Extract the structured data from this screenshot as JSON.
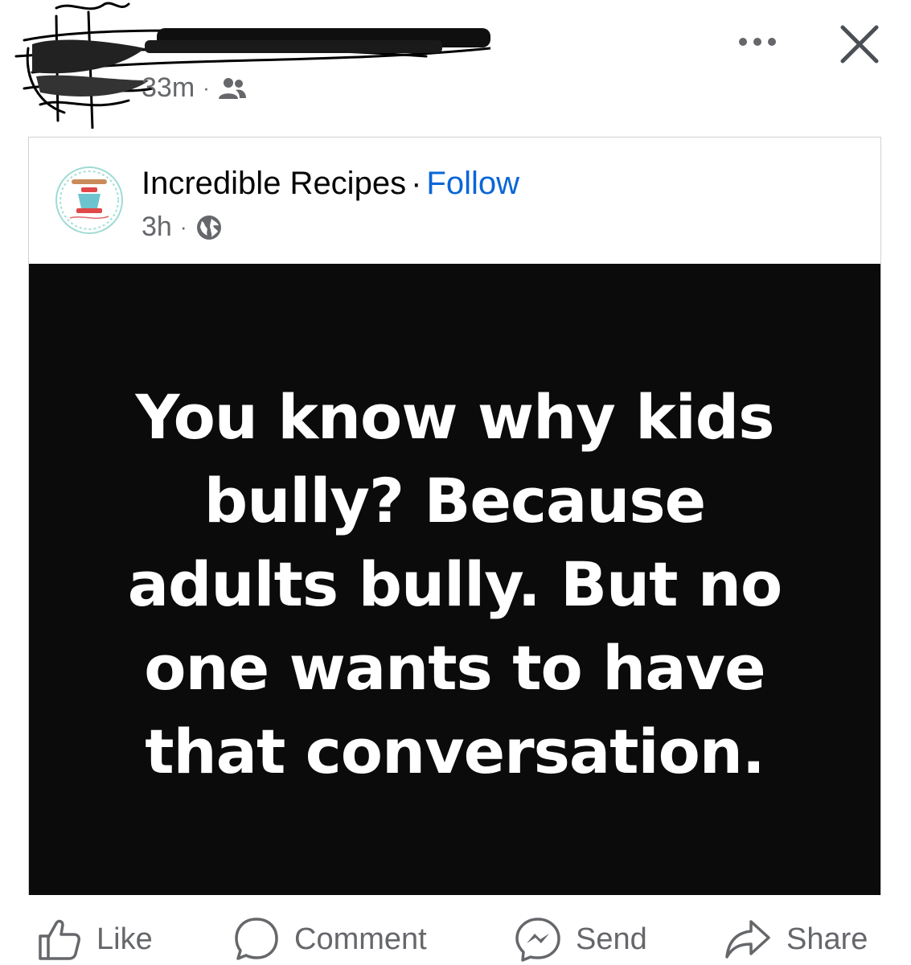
{
  "outer_post": {
    "timestamp": "33m",
    "separator": "·",
    "audience_icon": "friends-icon"
  },
  "header_actions": {
    "more_icon": "more-options-icon",
    "close_icon": "close-icon"
  },
  "shared_post": {
    "page_name": "Incredible Recipes",
    "title_separator": "·",
    "follow_label": "Follow",
    "timestamp": "3h",
    "meta_separator": "·",
    "audience_icon": "globe-icon",
    "quote": "You know why kids bully? Because adults bully. But no one wants to have that conversation.",
    "image_background": "#0b0b0b"
  },
  "actions": {
    "like_label": "Like",
    "comment_label": "Comment",
    "send_label": "Send",
    "share_label": "Share"
  },
  "colors": {
    "link_blue": "#0a66d8",
    "secondary_text": "#65676b",
    "border": "#cfd2d6"
  }
}
